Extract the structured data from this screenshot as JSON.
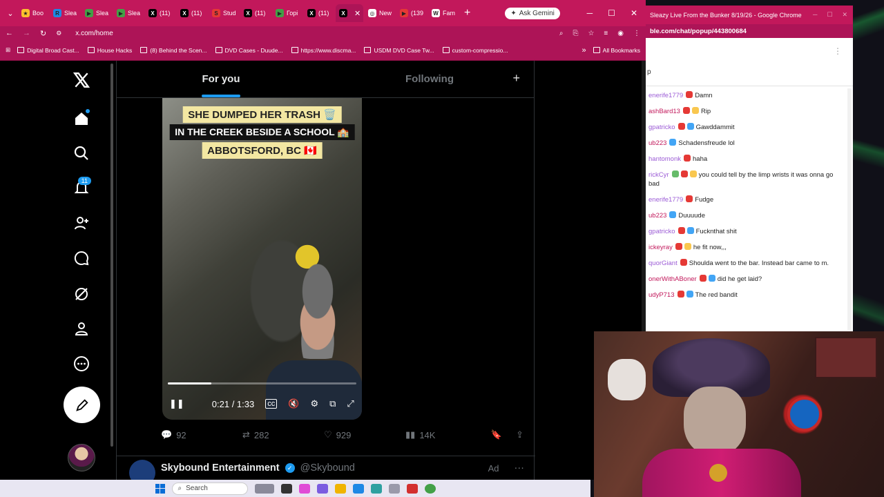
{
  "browser": {
    "tabs": [
      {
        "label": "Boo",
        "fav_color": "#fbc02d",
        "fav": "★"
      },
      {
        "label": "Slea",
        "fav_color": "#1e88e5",
        "fav": "R"
      },
      {
        "label": "Slea",
        "fav_color": "#43a047",
        "fav": "▶"
      },
      {
        "label": "Slea",
        "fav_color": "#43a047",
        "fav": "▶"
      },
      {
        "label": "(11)",
        "fav_color": "#000000",
        "fav": "X"
      },
      {
        "label": "(11)",
        "fav_color": "#000000",
        "fav": "X"
      },
      {
        "label": "Stud",
        "fav_color": "#e53935",
        "fav": "S"
      },
      {
        "label": "(11)",
        "fav_color": "#000000",
        "fav": "X"
      },
      {
        "label": "Горі",
        "fav_color": "#43a047",
        "fav": "▶"
      },
      {
        "label": "(11)",
        "fav_color": "#000000",
        "fav": "X"
      },
      {
        "label": "",
        "fav_color": "#000000",
        "fav": "X",
        "active": true
      },
      {
        "label": "New",
        "fav_color": "#ffffff",
        "fav": "◎"
      },
      {
        "label": "(139",
        "fav_color": "#e53935",
        "fav": "▶"
      },
      {
        "label": "Fam",
        "fav_color": "#ffffff",
        "fav": "W"
      }
    ],
    "gemini_label": "Ask Gemini",
    "url": "x.com/home",
    "bookmarks": [
      "Digital Broad Cast...",
      "House Hacks",
      "(8) Behind the Scen...",
      "DVD Cases - Duude...",
      "https://www.discma...",
      "USDM DVD Case Tw...",
      "custom-compressio..."
    ],
    "all_bookmarks": "All Bookmarks"
  },
  "x": {
    "notifications_badge": "11",
    "tabs": {
      "for_you": "For you",
      "following": "Following"
    },
    "plus": "+",
    "video": {
      "caption1": "SHE DUMPED HER TRASH 🗑️",
      "caption2": "IN THE CREEK BESIDE A SCHOOL 🏫",
      "caption3": "ABBOTSFORD, BC 🇨🇦",
      "time": "0:21 / 1:33",
      "progress": 0.23
    },
    "actions": {
      "replies": "92",
      "reposts": "282",
      "likes": "929",
      "views": "14K"
    },
    "next_post": {
      "name": "Skybound Entertainment",
      "handle": "@Skybound",
      "ad": "Ad",
      "more": "···"
    }
  },
  "taskbar": {
    "search": "Search"
  },
  "chat": {
    "title": "Sleazy Live From the Bunker 8/19/26 - Google Chrome",
    "url": "ble.com/chat/popup/443800684",
    "header_partial": "p",
    "messages": [
      {
        "user": "enerife1779",
        "user_color": "#9c5cd6",
        "badges": [
          "red"
        ],
        "text": "Damn"
      },
      {
        "user": "ashBard13",
        "user_color": "#c2185b",
        "badges": [
          "red",
          "gold"
        ],
        "text": "Rip"
      },
      {
        "user": "gpatricko",
        "user_color": "#9c5cd6",
        "badges": [
          "red",
          "blue"
        ],
        "text": "Gawddammit"
      },
      {
        "user": "ub223",
        "user_color": "#c2185b",
        "badges": [
          "blue"
        ],
        "text": "Schadensfreude lol"
      },
      {
        "user": "hantomonk",
        "user_color": "#9c5cd6",
        "badges": [
          "red"
        ],
        "text": "haha"
      },
      {
        "user": "rickCyr",
        "user_color": "#9c5cd6",
        "badges": [
          "green",
          "red",
          "gold"
        ],
        "text": "you could tell by the limp wrists it was onna go bad"
      },
      {
        "user": "enerife1779",
        "user_color": "#9c5cd6",
        "badges": [
          "red"
        ],
        "text": "Fudge"
      },
      {
        "user": "ub223",
        "user_color": "#c2185b",
        "badges": [
          "blue"
        ],
        "text": "Duuuude"
      },
      {
        "user": "gpatricko",
        "user_color": "#9c5cd6",
        "badges": [
          "red",
          "blue"
        ],
        "text": "Fucknthat shit"
      },
      {
        "user": "ickeyray",
        "user_color": "#c2185b",
        "badges": [
          "red",
          "gold"
        ],
        "text": "he fit now,,,"
      },
      {
        "user": "quorGiant",
        "user_color": "#9c5cd6",
        "badges": [
          "red"
        ],
        "text": "Shoulda went to the bar. Instead bar came to m."
      },
      {
        "user": "onerWithABoner",
        "user_color": "#c2185b",
        "badges": [
          "red",
          "blue"
        ],
        "text": "did he get laid?"
      },
      {
        "user": "udyP713",
        "user_color": "#c2185b",
        "badges": [
          "red",
          "blue"
        ],
        "text": "The red bandit"
      }
    ]
  }
}
